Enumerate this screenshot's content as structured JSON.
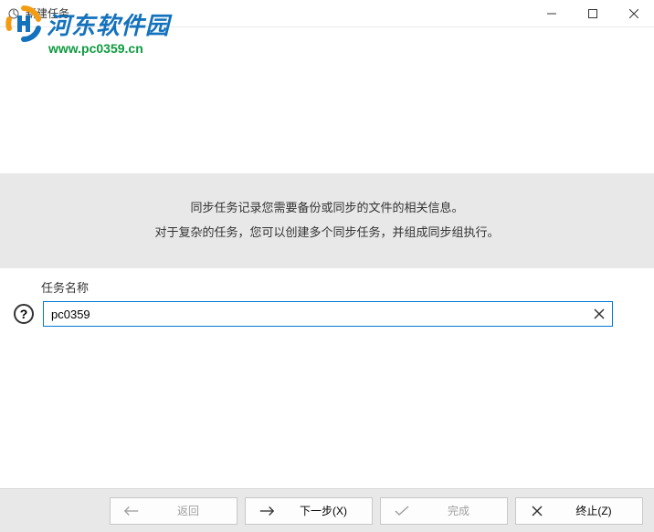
{
  "window": {
    "title": "新建任务"
  },
  "watermark": {
    "name": "河东软件园",
    "url": "www.pc0359.cn"
  },
  "info": {
    "line1": "同步任务记录您需要备份或同步的文件的相关信息。",
    "line2": "对于复杂的任务，您可以创建多个同步任务，并组成同步组执行。"
  },
  "form": {
    "task_name_label": "任务名称",
    "task_name_value": "pc0359"
  },
  "footer": {
    "back_label": "返回",
    "next_label": "下一步(X)",
    "finish_label": "完成",
    "abort_label": "终止(Z)"
  }
}
